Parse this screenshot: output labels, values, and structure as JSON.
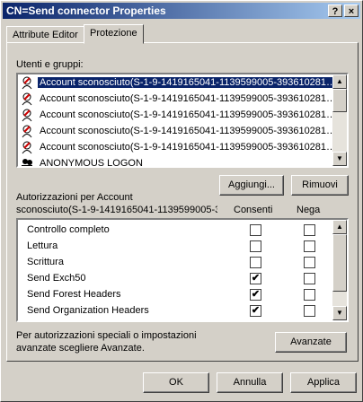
{
  "window": {
    "title": "CN=Send connector Properties",
    "help_label": "?",
    "close_label": "×"
  },
  "tabs": [
    {
      "label": "Attribute Editor"
    },
    {
      "label": "Protezione"
    }
  ],
  "users_label": "Utenti e gruppi:",
  "users": [
    {
      "name": "Account sconosciuto(S-1-9-1419165041-1139599005-393610281…",
      "selected": true
    },
    {
      "name": "Account sconosciuto(S-1-9-1419165041-1139599005-393610281…"
    },
    {
      "name": "Account sconosciuto(S-1-9-1419165041-1139599005-393610281…"
    },
    {
      "name": "Account sconosciuto(S-1-9-1419165041-1139599005-393610281…"
    },
    {
      "name": "Account sconosciuto(S-1-9-1419165041-1139599005-393610281…"
    },
    {
      "name": "ANONYMOUS LOGON"
    }
  ],
  "buttons": {
    "add": "Aggiungi...",
    "remove": "Rimuovi",
    "advanced": "Avanzate",
    "ok": "OK",
    "cancel": "Annulla",
    "apply": "Applica"
  },
  "permissions_label_1": "Autorizzazioni per Account",
  "permissions_label_2": "sconosciuto(S-1-9-1419165041-1139599005-3",
  "col_allow": "Consenti",
  "col_deny": "Nega",
  "permissions": [
    {
      "name": "Controllo completo",
      "allow": false,
      "deny": false
    },
    {
      "name": "Lettura",
      "allow": false,
      "deny": false
    },
    {
      "name": "Scrittura",
      "allow": false,
      "deny": false
    },
    {
      "name": "Send Exch50",
      "allow": true,
      "deny": false
    },
    {
      "name": "Send Forest Headers",
      "allow": true,
      "deny": false
    },
    {
      "name": "Send Organization Headers",
      "allow": true,
      "deny": false
    }
  ],
  "advanced_note_1": "Per autorizzazioni speciali o impostazioni",
  "advanced_note_2": "avanzate scegliere Avanzate.",
  "check_mark": "✔",
  "arrows": {
    "up": "▲",
    "down": "▼"
  }
}
